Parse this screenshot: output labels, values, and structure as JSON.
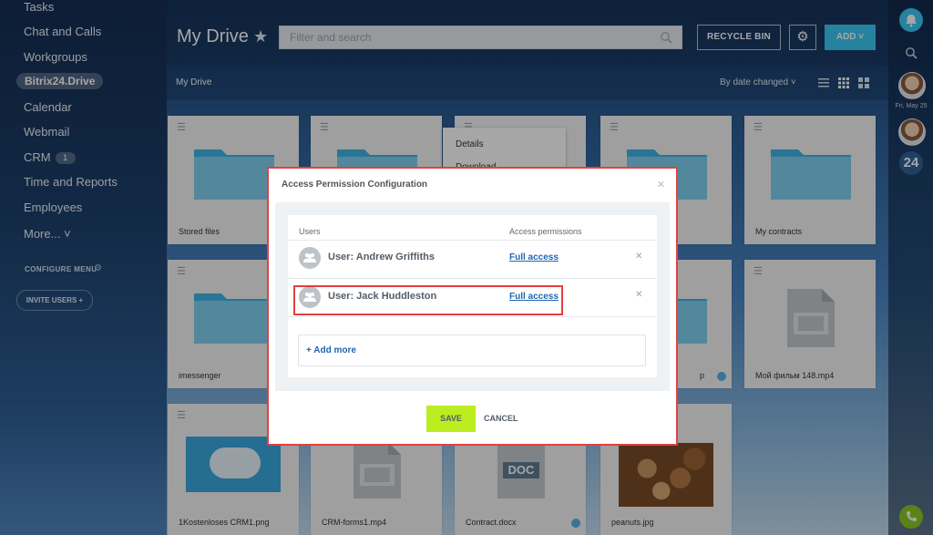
{
  "sidebar": {
    "items": [
      {
        "label": "Tasks"
      },
      {
        "label": "Chat and Calls"
      },
      {
        "label": "Workgroups"
      },
      {
        "label": "Bitrix24.Drive"
      },
      {
        "label": "Calendar"
      },
      {
        "label": "Webmail"
      },
      {
        "label": "CRM",
        "badge": "1"
      },
      {
        "label": "Time and Reports"
      },
      {
        "label": "Employees"
      },
      {
        "label": "More... ˅"
      }
    ],
    "configure_menu": "CONFIGURE MENU",
    "invite_users": "INVITE USERS +"
  },
  "header": {
    "title": "My Drive",
    "search_placeholder": "Filter and search",
    "recycle_bin": "RECYCLE BIN",
    "add": "ADD ˅"
  },
  "toolbar": {
    "breadcrumb": "My Drive",
    "sort_label": "By date changed ˅"
  },
  "right_panel": {
    "date": "Fri, May 25",
    "badge": "24"
  },
  "files": [
    {
      "name": "Stored files"
    },
    {
      "name": ""
    },
    {
      "name": ""
    },
    {
      "name": ""
    },
    {
      "name": "My contracts"
    },
    {
      "name": "imessenger"
    },
    {
      "name": "p"
    },
    {
      "name": "Мой фильм 148.mp4"
    },
    {
      "name": "1Kostenloses CRM1.png"
    },
    {
      "name": "CRM-forms1.mp4"
    },
    {
      "name": "Contract.docx",
      "doc_badge": "DOC"
    },
    {
      "name": "peanuts.jpg"
    }
  ],
  "context_menu": {
    "items": [
      "Details",
      "Download"
    ]
  },
  "dialog": {
    "title": "Access Permission Configuration",
    "column_users": "Users",
    "column_permissions": "Access permissions",
    "rows": [
      {
        "user": "User: Andrew Griffiths",
        "permission": "Full access"
      },
      {
        "user": "User: Jack Huddleston",
        "permission": "Full access"
      }
    ],
    "add_more": "+ Add more",
    "save": "SAVE",
    "cancel": "CANCEL"
  },
  "colors": {
    "accent": "#3bc8f5",
    "save_button": "#bbed21",
    "highlight": "#e34040",
    "link": "#2067b0"
  }
}
